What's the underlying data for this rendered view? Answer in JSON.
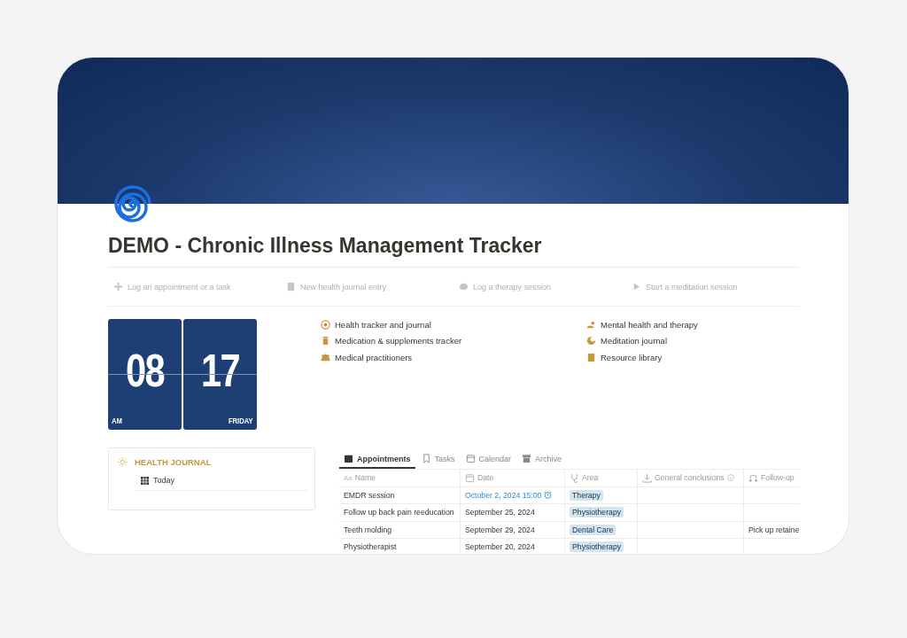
{
  "page": {
    "title": "DEMO - Chronic Illness Management Tracker"
  },
  "quick_buttons": [
    {
      "label": "Log an appointment or a task"
    },
    {
      "label": "New health journal entry"
    },
    {
      "label": "Log a therapy session"
    },
    {
      "label": "Start a meditation session"
    }
  ],
  "clock": {
    "hour": "08",
    "minute": "17",
    "period": "AM",
    "weekday": "FRIDAY"
  },
  "links": [
    {
      "label": "Health tracker and journal"
    },
    {
      "label": "Mental health and therapy"
    },
    {
      "label": "Medication & supplements tracker"
    },
    {
      "label": "Meditation journal"
    },
    {
      "label": "Medical practitioners"
    },
    {
      "label": "Resource library"
    }
  ],
  "journal": {
    "title": "HEALTH JOURNAL",
    "items": [
      {
        "label": "Today"
      }
    ]
  },
  "tabs": [
    {
      "label": "Appointments",
      "selected": true
    },
    {
      "label": "Tasks",
      "selected": false
    },
    {
      "label": "Calendar",
      "selected": false
    },
    {
      "label": "Archive",
      "selected": false
    }
  ],
  "table": {
    "columns": [
      {
        "label": "Name",
        "prefix": "Aa"
      },
      {
        "label": "Date"
      },
      {
        "label": "Area"
      },
      {
        "label": "General conclusions",
        "info": true
      },
      {
        "label": "Follow-up"
      }
    ],
    "rows": [
      {
        "name": "EMDR session",
        "date": "October 2, 2024 15:00",
        "reminder": true,
        "area": "Therapy"
      },
      {
        "name": "Follow up back pain reeducation",
        "date": "September 25, 2024",
        "reminder": false,
        "area": "Physiotherapy"
      },
      {
        "name": "Teeth molding",
        "date": "September 29, 2024",
        "reminder": false,
        "area": "Dental Care",
        "follow_up": "Pick up retaine"
      },
      {
        "name": "Physiotherapist",
        "date": "September 20, 2024",
        "reminder": false,
        "area": "Physiotherapy"
      }
    ]
  }
}
